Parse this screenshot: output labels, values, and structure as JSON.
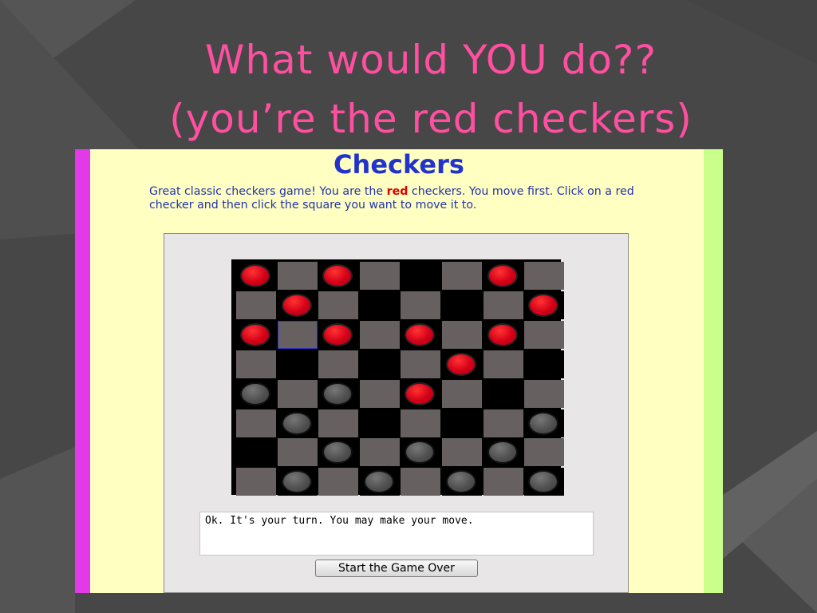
{
  "slide": {
    "title_line_1": "What would YOU do??",
    "title_line_2": "(you’re the red checkers)"
  },
  "game": {
    "heading": "Checkers",
    "instructions_before": "Great classic checkers game! You are the ",
    "instructions_highlight": "red",
    "instructions_after": " checkers. You move first. Click on a red checker and then click the square you want to move it to.",
    "status_message": "Ok. It's your turn. You may make your move.",
    "restart_label": "Start the Game Over",
    "colors": {
      "heading": "#2233cc",
      "instructions": "#2233aa",
      "highlight": "#e00000",
      "page_background": "#ffffc2",
      "left_strip": "#e23ae6",
      "right_strip": "#caff8c"
    }
  },
  "board": {
    "rows": 8,
    "cols": 8,
    "selected_square": [
      2,
      1
    ],
    "pieces": [
      [
        "red",
        "empty",
        "red",
        "empty",
        "empty",
        "empty",
        "red",
        "empty"
      ],
      [
        "empty",
        "red",
        "empty",
        "empty",
        "empty",
        "empty",
        "empty",
        "red"
      ],
      [
        "red",
        "empty",
        "red",
        "empty",
        "red",
        "empty",
        "red",
        "empty"
      ],
      [
        "empty",
        "empty",
        "empty",
        "empty",
        "empty",
        "red",
        "empty",
        "empty"
      ],
      [
        "black",
        "empty",
        "black",
        "empty",
        "red",
        "empty",
        "empty",
        "empty"
      ],
      [
        "empty",
        "black",
        "empty",
        "empty",
        "empty",
        "empty",
        "empty",
        "black"
      ],
      [
        "empty",
        "empty",
        "black",
        "empty",
        "black",
        "empty",
        "black",
        "empty"
      ],
      [
        "empty",
        "black",
        "empty",
        "black",
        "empty",
        "black",
        "empty",
        "black"
      ]
    ]
  }
}
